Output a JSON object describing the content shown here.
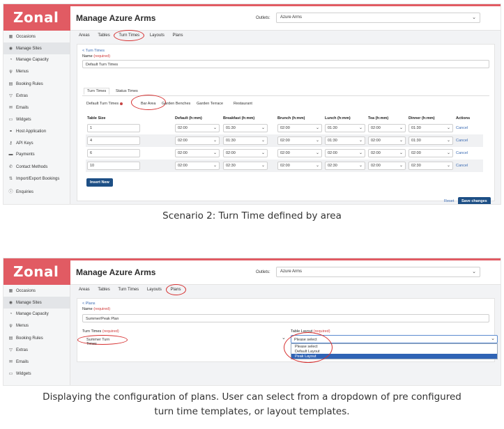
{
  "brand": {
    "logo_text": "Zonal",
    "color": "#e15b63"
  },
  "header": {
    "title": "Manage Azure Arms",
    "outlets_label": "Outlets:",
    "outlets_value": "Azure Arms"
  },
  "sidebar": {
    "items": [
      {
        "label": "Occasions",
        "icon": "calendar-grid-icon"
      },
      {
        "label": "Manage Sites",
        "icon": "location-pin-icon",
        "active": true
      },
      {
        "label": "Manage Capacity",
        "icon": "capacity-icon"
      },
      {
        "label": "Menus",
        "icon": "cutlery-icon"
      },
      {
        "label": "Booking Rules",
        "icon": "book-icon"
      },
      {
        "label": "Extras",
        "icon": "glass-icon"
      },
      {
        "label": "Emails",
        "icon": "envelope-icon"
      },
      {
        "label": "Widgets",
        "icon": "widget-icon"
      },
      {
        "label": "Host Application",
        "icon": "host-icon"
      },
      {
        "label": "API Keys",
        "icon": "key-icon"
      },
      {
        "label": "Payments",
        "icon": "card-icon"
      },
      {
        "label": "Contact Methods",
        "icon": "phone-icon"
      },
      {
        "label": "Import/Export Bookings",
        "icon": "import-export-icon"
      },
      {
        "label": "Enquiries",
        "icon": "info-icon"
      }
    ]
  },
  "tabs": [
    "Areas",
    "Tables",
    "Turn Times",
    "Layouts",
    "Plans"
  ],
  "scenario1": {
    "back_label": "< Turn Times",
    "name_label": "Name",
    "required": "(required)",
    "name_value": "Default Turn Times",
    "subtabs": [
      "Turn Times",
      "Status Times"
    ],
    "area_tabs": [
      "Default Turn Times",
      "Bar Area",
      "Garden Benches",
      "Garden Terrace",
      "Restaurant"
    ],
    "columns": [
      "Table Size",
      "Default (h:mm)",
      "Breakfast (h:mm)",
      "Brunch (h:mm)",
      "Lunch (h:mm)",
      "Tea (h:mm)",
      "Dinner (h:mm)",
      "Actions"
    ],
    "rows": [
      {
        "size": "1",
        "times": [
          "02:00",
          "01:30",
          "02:00",
          "01:30",
          "02:00",
          "01:30"
        ],
        "action": "Cancel"
      },
      {
        "size": "4",
        "times": [
          "02:00",
          "01:30",
          "02:00",
          "01:30",
          "02:00",
          "01:30"
        ],
        "action": "Cancel"
      },
      {
        "size": "6",
        "times": [
          "02:00",
          "02:00",
          "02:00",
          "02:00",
          "02:00",
          "02:00"
        ],
        "action": "Cancel"
      },
      {
        "size": "10",
        "times": [
          "02:00",
          "02:30",
          "02:00",
          "02:30",
          "02:00",
          "02:30"
        ],
        "action": "Cancel"
      }
    ],
    "insert_label": "Insert New",
    "reset_label": "Reset",
    "save_label": "Save changes"
  },
  "caption1": "Scenario 2: Turn Time defined by area",
  "scenario2": {
    "back_label": "< Plans",
    "name_label": "Name",
    "required": "(required)",
    "name_value": "Summer/Peak Plan",
    "turn_times_label": "Turn Times",
    "turn_times_value": "Summer Turn Times",
    "layout_label": "Table Layout",
    "layout_value": "Please select",
    "layout_options": [
      "Please select",
      "Default Layout",
      "Peak Layout"
    ],
    "layout_selected_index": 2
  },
  "caption2_line1": "Displaying the configuration of plans. User can select from a dropdown of pre configured",
  "caption2_line2": "turn time templates, or layout templates.",
  "colors": {
    "accent_red": "#e15b63",
    "primary_button": "#1d4f85",
    "link": "#3a6ab3",
    "annotation_circle": "#d63030"
  }
}
